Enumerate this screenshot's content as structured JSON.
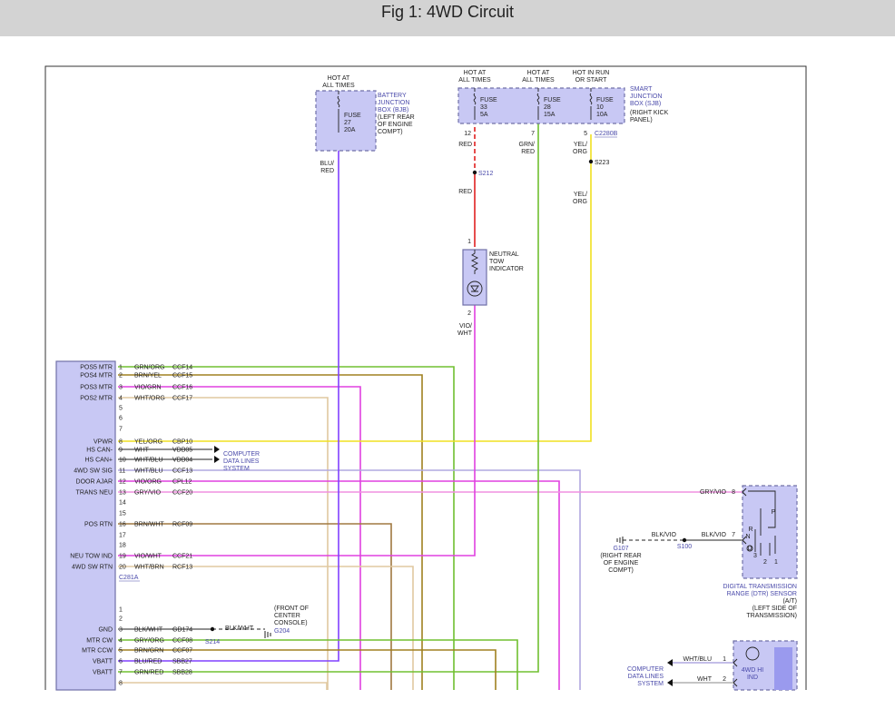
{
  "header": {
    "title": "Fig 1: 4WD Circuit"
  },
  "colors": {
    "module_fill": "#c8c8f4",
    "module_stroke": "#7070a8",
    "label_blue": "#4a4aaa",
    "wire_violet": "#8040ff",
    "wire_green": "#70c030",
    "wire_olive": "#a08020",
    "wire_magenta": "#e040e0",
    "wire_tan": "#e0c8a0",
    "wire_yellow": "#f0e020",
    "wire_red": "#e02020",
    "wire_brown": "#a07840",
    "wire_lavender": "#b0a8e0",
    "wire_pink": "#f090e0"
  },
  "battery_junction_box": {
    "hot": [
      "HOT AT",
      "ALL TIMES"
    ],
    "label": [
      "BATTERY",
      "JUNCTION",
      "BOX (BJB)"
    ],
    "location": [
      "(LEFT REAR",
      "OF ENGINE",
      "COMPT)"
    ],
    "fuse": [
      "FUSE",
      "27",
      "20A"
    ]
  },
  "smart_junction_box": {
    "label": [
      "SMART",
      "JUNCTION",
      "BOX (SJB)"
    ],
    "location": [
      "(RIGHT KICK",
      "PANEL)"
    ],
    "connector": "C2280B",
    "fuses": [
      {
        "hot": [
          "HOT AT",
          "ALL TIMES"
        ],
        "fuse": [
          "FUSE",
          "33",
          "5A"
        ],
        "pin": "12"
      },
      {
        "hot": [
          "HOT AT",
          "ALL TIMES"
        ],
        "fuse": [
          "FUSE",
          "28",
          "15A"
        ],
        "pin": "7"
      },
      {
        "hot": [
          "HOT IN RUN",
          "OR START"
        ],
        "fuse": [
          "FUSE",
          "10",
          "10A"
        ],
        "pin": "5"
      }
    ]
  },
  "wire_labels": {
    "blu_red": [
      "BLU/",
      "RED"
    ],
    "red": "RED",
    "grn_red": [
      "GRN/",
      "RED"
    ],
    "yel_org": [
      "YEL/",
      "ORG"
    ],
    "vio_wht": [
      "VIO/",
      "WHT"
    ],
    "gry_vio": "GRY/VIO",
    "blk_vio": "BLK/VIO",
    "blk_wht": "BLK/WHT",
    "wht_blu": "WHT/BLU",
    "wht": "WHT"
  },
  "splices": {
    "s212": "S212",
    "s223": "S223",
    "s214": "S214",
    "s100": "S100"
  },
  "neutral_tow_indicator": {
    "label": [
      "NEUTRAL",
      "TOW",
      "INDICATOR"
    ],
    "pin_top": "1",
    "pin_bottom": "2"
  },
  "module": {
    "connector_1": "C281A",
    "pins_1": [
      {
        "n": "1",
        "name": "POS5 MTR",
        "wire": "GRN/ORG",
        "circuit": "CCF14"
      },
      {
        "n": "2",
        "name": "POS4 MTR",
        "wire": "BRN/YEL",
        "circuit": "CCF15"
      },
      {
        "n": "3",
        "name": "POS3 MTR",
        "wire": "VIO/GRN",
        "circuit": "CCF16"
      },
      {
        "n": "4",
        "name": "POS2 MTR",
        "wire": "WHT/ORG",
        "circuit": "CCF17"
      },
      {
        "n": "5",
        "name": "",
        "wire": "",
        "circuit": ""
      },
      {
        "n": "6",
        "name": "",
        "wire": "",
        "circuit": ""
      },
      {
        "n": "7",
        "name": "",
        "wire": "",
        "circuit": ""
      },
      {
        "n": "8",
        "name": "VPWR",
        "wire": "YEL/ORG",
        "circuit": "CBP10"
      },
      {
        "n": "9",
        "name": "HS CAN-",
        "wire": "WHT",
        "circuit": "VDB05"
      },
      {
        "n": "10",
        "name": "HS CAN+",
        "wire": "WHT/BLU",
        "circuit": "VDB04"
      },
      {
        "n": "11",
        "name": "4WD SW SIG",
        "wire": "WHT/BLU",
        "circuit": "CCF13"
      },
      {
        "n": "12",
        "name": "DOOR AJAR",
        "wire": "VIO/ORG",
        "circuit": "CPL12"
      },
      {
        "n": "13",
        "name": "TRANS NEU",
        "wire": "GRY/VIO",
        "circuit": "CCF20"
      },
      {
        "n": "14",
        "name": "",
        "wire": "",
        "circuit": ""
      },
      {
        "n": "15",
        "name": "",
        "wire": "",
        "circuit": ""
      },
      {
        "n": "16",
        "name": "POS RTN",
        "wire": "BRN/WHT",
        "circuit": "RCF09"
      },
      {
        "n": "17",
        "name": "",
        "wire": "",
        "circuit": ""
      },
      {
        "n": "18",
        "name": "",
        "wire": "",
        "circuit": ""
      },
      {
        "n": "19",
        "name": "NEU TOW IND",
        "wire": "VIO/WHT",
        "circuit": "CCF21"
      },
      {
        "n": "20",
        "name": "4WD SW RTN",
        "wire": "WHT/BRN",
        "circuit": "RCF13"
      }
    ],
    "pins_2": [
      {
        "n": "1",
        "name": "",
        "wire": "",
        "circuit": ""
      },
      {
        "n": "2",
        "name": "",
        "wire": "",
        "circuit": ""
      },
      {
        "n": "3",
        "name": "GND",
        "wire": "BLK/WHT",
        "circuit": "GD174"
      },
      {
        "n": "4",
        "name": "MTR CW",
        "wire": "GRY/ORG",
        "circuit": "CCF08"
      },
      {
        "n": "5",
        "name": "MTR CCW",
        "wire": "BRN/GRN",
        "circuit": "CCF07"
      },
      {
        "n": "6",
        "name": "VBATT",
        "wire": "BLU/RED",
        "circuit": "SBB27"
      },
      {
        "n": "7",
        "name": "VBATT",
        "wire": "GRN/RED",
        "circuit": "SBB28"
      },
      {
        "n": "8",
        "name": "",
        "wire": "",
        "circuit": ""
      }
    ]
  },
  "computer_data_lines": [
    "COMPUTER",
    "DATA LINES",
    "SYSTEM"
  ],
  "ground_g204": {
    "label": "G204",
    "location": [
      "(FRONT OF",
      "CENTER",
      "CONSOLE)"
    ]
  },
  "ground_g107": {
    "label": "G107",
    "location": [
      "(RIGHT REAR",
      "OF ENGINE",
      "COMPT)"
    ]
  },
  "dtr_sensor": {
    "label": [
      "DIGITAL TRANSMISSION",
      "RANGE (DTR) SENSOR",
      "(A/T)",
      "(LEFT SIDE OF",
      "TRANSMISSION)"
    ],
    "pin_8": "8",
    "pin_7": "7",
    "positions": [
      "P",
      "R",
      "N",
      "D",
      "3",
      "2",
      "1"
    ]
  },
  "hi_ind": {
    "label": [
      "4WD HI",
      "IND"
    ],
    "pin_1": "1",
    "pin_2": "2"
  }
}
